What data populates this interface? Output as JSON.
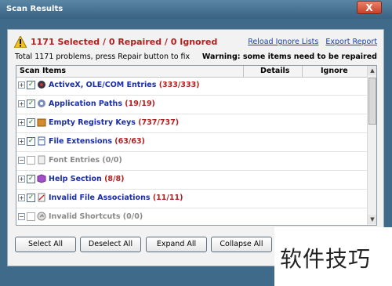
{
  "window": {
    "title": "Scan Results",
    "close_label": "X"
  },
  "summary": {
    "status": "1171 Selected / 0 Repaired / 0 Ignored",
    "links": [
      "Reload Ignore Lists",
      "Export Report"
    ],
    "total_text": "Total 1171 problems, press Repair button to fix",
    "warning_text": "Warning: some items need to be repaired"
  },
  "table": {
    "columns": [
      "Scan Items",
      "Details",
      "Ignore"
    ],
    "rows": [
      {
        "label": "ActiveX, OLE/COM Entries",
        "count": "(333/333)",
        "checked": true,
        "enabled": true,
        "icon": "activex-icon"
      },
      {
        "label": "Application Paths",
        "count": "(19/19)",
        "checked": true,
        "enabled": true,
        "icon": "gear-icon"
      },
      {
        "label": "Empty Registry Keys",
        "count": "(737/737)",
        "checked": true,
        "enabled": true,
        "icon": "box-icon"
      },
      {
        "label": "File Extensions",
        "count": "(63/63)",
        "checked": true,
        "enabled": true,
        "icon": "file-icon"
      },
      {
        "label": "Font Entries",
        "count": "(0/0)",
        "checked": false,
        "enabled": false,
        "icon": "font-icon"
      },
      {
        "label": "Help Section",
        "count": "(8/8)",
        "checked": true,
        "enabled": true,
        "icon": "help-icon"
      },
      {
        "label": "Invalid File Associations",
        "count": "(11/11)",
        "checked": true,
        "enabled": true,
        "icon": "file-association-icon"
      },
      {
        "label": "Invalid Shortcuts",
        "count": "(0/0)",
        "checked": false,
        "enabled": false,
        "icon": "shortcut-icon"
      }
    ]
  },
  "buttons": {
    "select_all": "Select All",
    "deselect_all": "Deselect All",
    "expand_all": "Expand All",
    "collapse_all": "Collapse All"
  },
  "watermark": "软件技巧"
}
